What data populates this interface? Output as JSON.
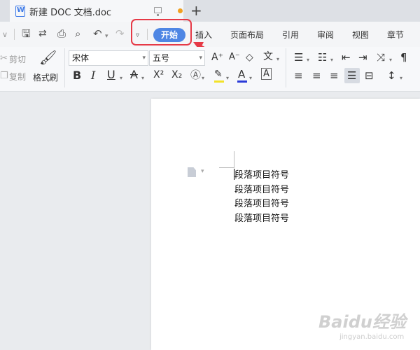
{
  "window": {
    "doc_title": "新建 DOC 文档.doc",
    "new_tab_symbol": "+"
  },
  "toolbar": {
    "tabs": [
      "插入",
      "页面布局",
      "引用",
      "审阅",
      "视图",
      "章节"
    ],
    "active_tab": "开始",
    "accent_color": "#4e86e4",
    "highlight_color": "#e63946"
  },
  "ribbon": {
    "cut_label": "剪切",
    "copy_label": "复制",
    "format_painter_label": "格式刷",
    "font_name": "宋体",
    "font_size": "五号",
    "bold": "B",
    "italic": "I",
    "underline": "U",
    "strikethrough": "A",
    "superscript": "X²",
    "subscript": "X₂",
    "font_color_label": "A",
    "char_shading_label": "A",
    "font_color": "#2b3bd8",
    "highlight_fill": "#f2e229"
  },
  "document": {
    "paragraphs": [
      "段落项目符号",
      "段落项目符号",
      "段落项目符号",
      "段落项目符号"
    ]
  },
  "watermark": {
    "text": "Baidu经验",
    "sub": "jingyan.baidu.com"
  }
}
